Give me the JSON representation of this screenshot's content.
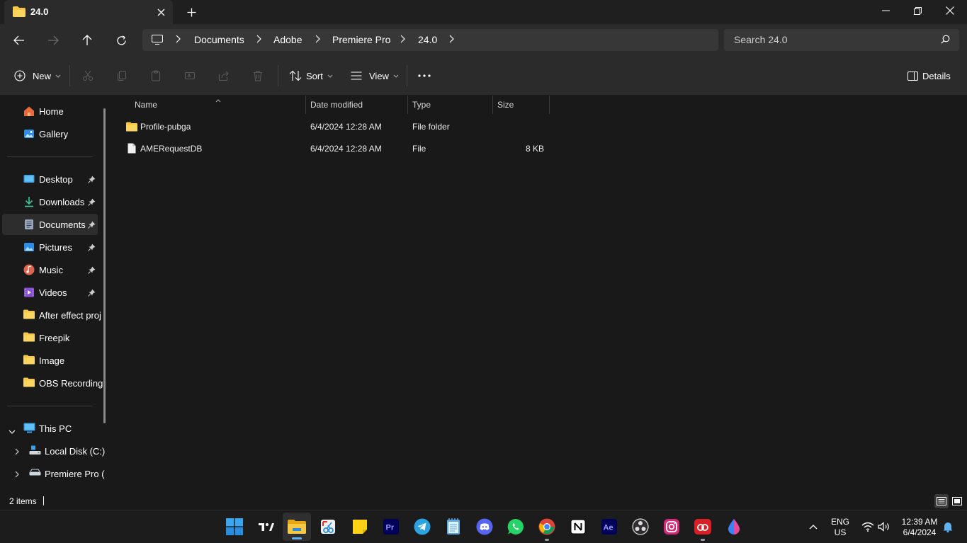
{
  "window": {
    "tab_title": "24.0"
  },
  "address": {
    "crumbs": [
      "Documents",
      "Adobe",
      "Premiere Pro",
      "24.0"
    ],
    "search_placeholder": "Search 24.0"
  },
  "toolbar": {
    "new_label": "New",
    "sort_label": "Sort",
    "view_label": "View",
    "details_label": "Details"
  },
  "sidebar": {
    "top": [
      {
        "label": "Home",
        "icon": "home-icon"
      },
      {
        "label": "Gallery",
        "icon": "gallery-icon"
      }
    ],
    "quick_access": [
      {
        "label": "Desktop",
        "icon": "desktop-icon",
        "pinned": true
      },
      {
        "label": "Downloads",
        "icon": "download-icon",
        "pinned": true
      },
      {
        "label": "Documents",
        "icon": "documents-icon",
        "pinned": true,
        "selected": true
      },
      {
        "label": "Pictures",
        "icon": "pictures-icon",
        "pinned": true
      },
      {
        "label": "Music",
        "icon": "music-icon",
        "pinned": true
      },
      {
        "label": "Videos",
        "icon": "videos-icon",
        "pinned": true
      },
      {
        "label": "After effect proj",
        "icon": "folder-icon",
        "pinned": false
      },
      {
        "label": "Freepik",
        "icon": "folder-icon",
        "pinned": false
      },
      {
        "label": "Image",
        "icon": "folder-icon",
        "pinned": false
      },
      {
        "label": "OBS Recording",
        "icon": "folder-icon",
        "pinned": false
      }
    ],
    "this_pc": "This PC",
    "drives": [
      {
        "label": "Local Disk (C:)",
        "icon": "drive-icon"
      },
      {
        "label": "Premiere Pro (",
        "icon": "drive-icon"
      }
    ]
  },
  "columns": {
    "name": "Name",
    "date": "Date modified",
    "type": "Type",
    "size": "Size"
  },
  "files": [
    {
      "name": "Profile-pubga",
      "date": "6/4/2024 12:28 AM",
      "type": "File folder",
      "size": "",
      "icon": "folder-icon"
    },
    {
      "name": "AMERequestDB",
      "date": "6/4/2024 12:28 AM",
      "type": "File",
      "size": "8 KB",
      "icon": "file-icon"
    }
  ],
  "status": {
    "item_count": "2 items"
  },
  "taskbar": {
    "apps": [
      "start",
      "tradingview",
      "snipping-tool",
      "sticky-notes",
      "premiere-pro",
      "telegram",
      "notepad",
      "discord",
      "whatsapp",
      "chrome",
      "notion",
      "after-effects",
      "obs",
      "instagram",
      "creative-cloud",
      "color-picker"
    ],
    "active_app": "file-explorer"
  },
  "tray": {
    "lang_top": "ENG",
    "lang_bottom": "US",
    "time": "12:39 AM",
    "date": "6/4/2024"
  }
}
